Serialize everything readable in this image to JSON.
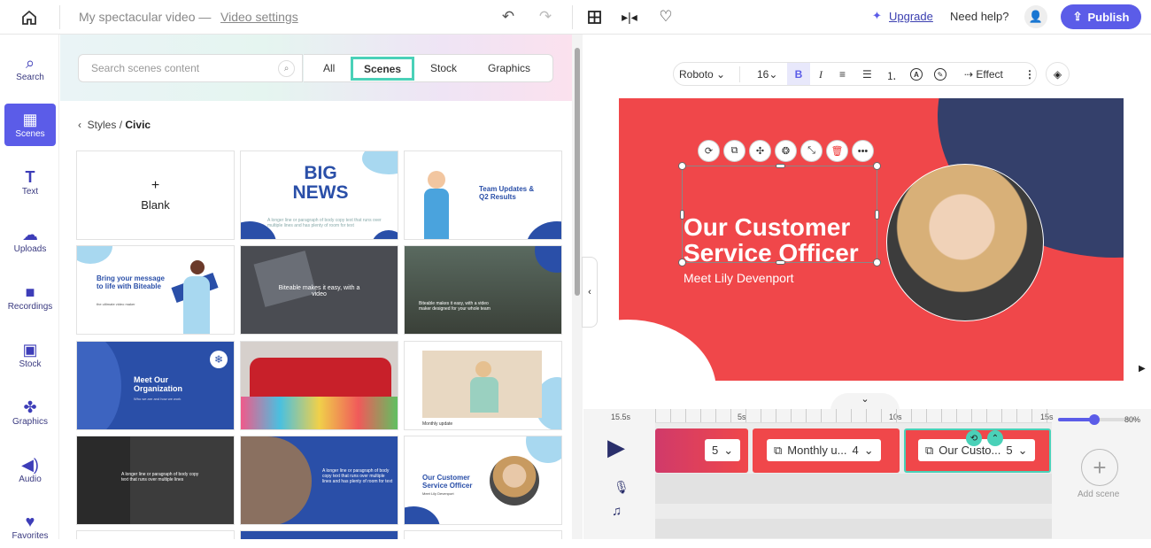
{
  "topbar": {
    "video_title": "My spectacular video",
    "sep": "—",
    "settings_link": "Video settings",
    "upgrade": "Upgrade",
    "help": "Need help?",
    "publish": "Publish"
  },
  "rail": [
    {
      "label": "Search",
      "icon": "search-icon",
      "glyph": "⌕"
    },
    {
      "label": "Scenes",
      "icon": "scenes-icon",
      "glyph": "▦"
    },
    {
      "label": "Text",
      "icon": "text-icon",
      "glyph": "T"
    },
    {
      "label": "Uploads",
      "icon": "upload-icon",
      "glyph": "☁"
    },
    {
      "label": "Recordings",
      "icon": "record-icon",
      "glyph": "■"
    },
    {
      "label": "Stock",
      "icon": "stock-icon",
      "glyph": "▣"
    },
    {
      "label": "Graphics",
      "icon": "graphics-icon",
      "glyph": "✤"
    },
    {
      "label": "Audio",
      "icon": "audio-icon",
      "glyph": "◀)"
    },
    {
      "label": "Favorites",
      "icon": "heart-icon",
      "glyph": "♥"
    }
  ],
  "panel": {
    "search_placeholder": "Search scenes content",
    "tabs": [
      "All",
      "Scenes",
      "Stock",
      "Graphics"
    ],
    "breadcrumb": {
      "parent": "Styles",
      "sep": "/",
      "current": "Civic"
    },
    "tiles": {
      "blank": "Blank",
      "t1": "BIG NEWS",
      "t1_body": "A longer line or paragraph of body copy text that runs over multiple lines and has plenty of room for text",
      "t2": "Team Updates & Q2 Results",
      "t3": "Bring your message to life with Biteable",
      "t3_sub": "the ultimate video maker",
      "t4": "Biteable makes it easy, with a video",
      "t5": "Biteable makes it easy, with a video maker designed for your whole team",
      "t6": "Meet Our Organization",
      "t6_sub": "Who we are and how we work",
      "t8": "Monthly update",
      "t9_body": "A longer line or paragraph of body copy text that runs over multiple lines",
      "t10_body": "A longer line or paragraph of body copy text that runs over multiple lines and has plenty of room for text",
      "t11": "Our Customer Service Officer",
      "t11_sub": "Meet Lily Devenport"
    }
  },
  "editor": {
    "font": "Roboto",
    "size": "16",
    "bold": "B",
    "italic": "I",
    "effect": "Effect",
    "headline_1": "Our Customer",
    "headline_2": "Service Officer",
    "subtitle": "Meet Lily Devenport"
  },
  "timeline": {
    "ticks": [
      "15.5s",
      "5s",
      "10s",
      "15s"
    ],
    "zoom": "80%",
    "zoom_level": 0.45,
    "clips": [
      {
        "label": "",
        "count": "5"
      },
      {
        "label": "Monthly u...",
        "count": "4"
      },
      {
        "label": "Our Custo...",
        "count": "5"
      }
    ],
    "add_scene": "Add scene"
  },
  "colors": {
    "accent": "#5b5ce8",
    "scene_red": "#f0474a",
    "navy": "#34406b",
    "tab_highlight": "#4ad1b8"
  }
}
